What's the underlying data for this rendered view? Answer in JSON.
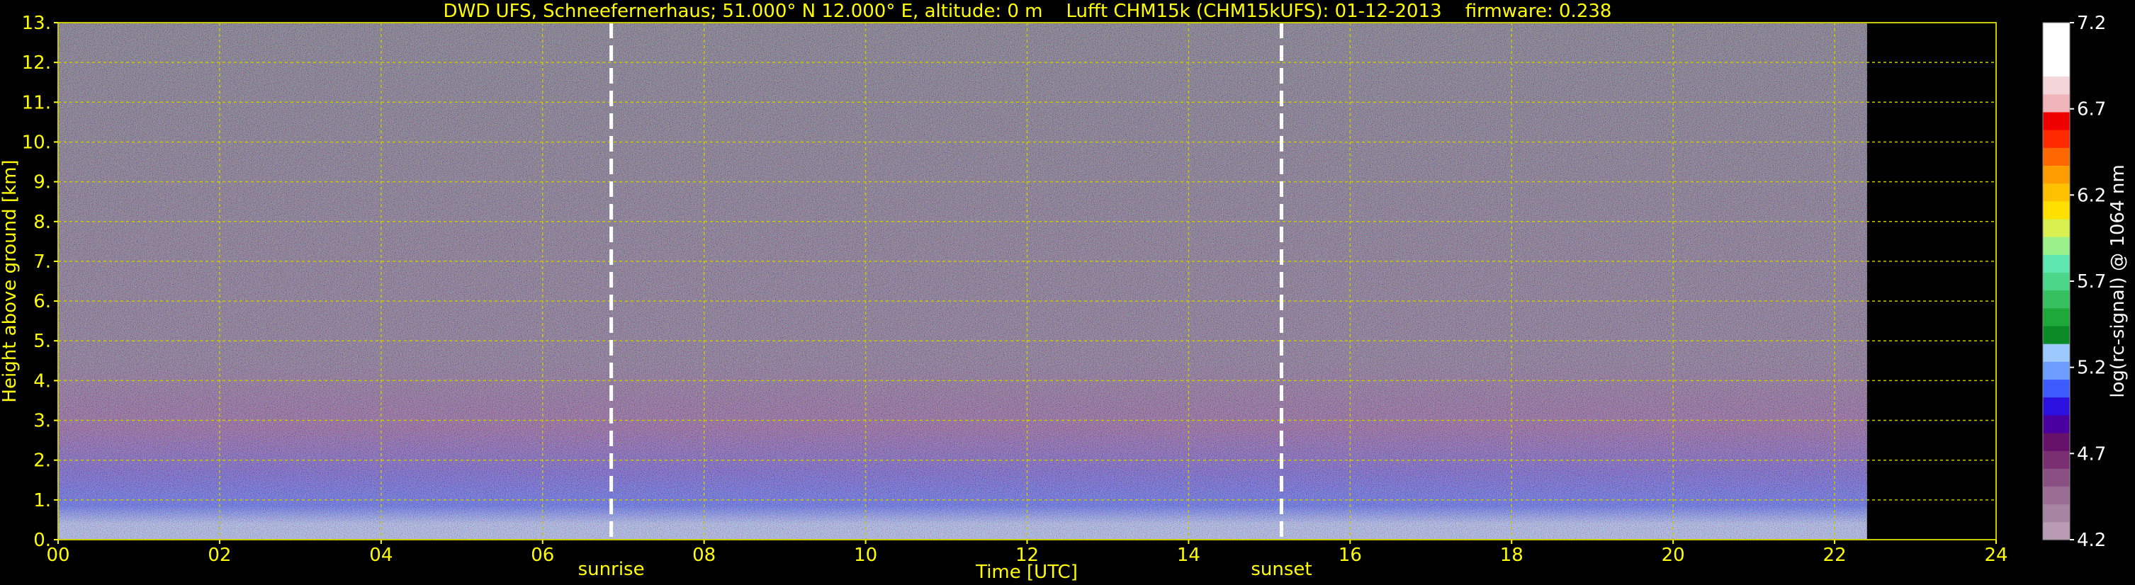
{
  "chart_data": {
    "type": "heatmap",
    "title": "DWD UFS, Schneefernerhaus; 51.000° N 12.000° E, altitude: 0 m    Lufft CHM15k (CHM15kUFS): 01-12-2013    firmware: 0.238",
    "xlabel": "Time [UTC]",
    "ylabel": "Height above ground [km]",
    "xlim": [
      0,
      24
    ],
    "ylim": [
      0,
      13
    ],
    "x_ticks": [
      "00",
      "02",
      "04",
      "06",
      "08",
      "10",
      "12",
      "14",
      "16",
      "18",
      "20",
      "22",
      "24"
    ],
    "y_ticks": [
      "0.",
      "1.",
      "2.",
      "3.",
      "4.",
      "5.",
      "6.",
      "7.",
      "8.",
      "9.",
      "10.",
      "11.",
      "12.",
      "13."
    ],
    "grid": true,
    "data_end_hour": 22.4,
    "events": [
      {
        "label": "sunrise",
        "hour": 6.85
      },
      {
        "label": "sunset",
        "hour": 15.15
      }
    ],
    "colorbar": {
      "label": "log(rc-signal) @ 1064 nm",
      "range": [
        4.2,
        7.2
      ],
      "ticks": [
        "4.2",
        "4.7",
        "5.2",
        "5.7",
        "6.2",
        "6.7",
        "7.2"
      ],
      "colors": [
        "#b99bb3",
        "#a884a3",
        "#9a6d94",
        "#8a4f83",
        "#7a2f73",
        "#66126a",
        "#4a00a0",
        "#2c10e0",
        "#3d5cff",
        "#6d9cff",
        "#9ccaff",
        "#0b8a28",
        "#1fa83a",
        "#37c060",
        "#4bd68a",
        "#5ee8b0",
        "#9af08a",
        "#d8f050",
        "#ffe000",
        "#ffc000",
        "#ff9c00",
        "#ff6800",
        "#ff2a00",
        "#ee0000",
        "#f0b4b8",
        "#f4d6da",
        "#ffffff",
        "#ffffff",
        "#ffffff"
      ]
    },
    "profile_layers": [
      {
        "height_km": 0.4,
        "color": "#a8b8ff"
      },
      {
        "height_km": 0.85,
        "color": "#2a40ff"
      },
      {
        "height_km": 1.7,
        "color": "#4a2ad0"
      },
      {
        "height_km": 2.8,
        "color": "#7a2f88"
      },
      {
        "height_km": 4.5,
        "color": "#6a4a78"
      },
      {
        "height_km": 13.0,
        "color": "#5a5066"
      }
    ],
    "colors": {
      "text": "#ffff00",
      "grid": "#c8c800",
      "event_line": "#ffffff",
      "background": "#000000",
      "colorbar_text": "#ffffff"
    }
  }
}
